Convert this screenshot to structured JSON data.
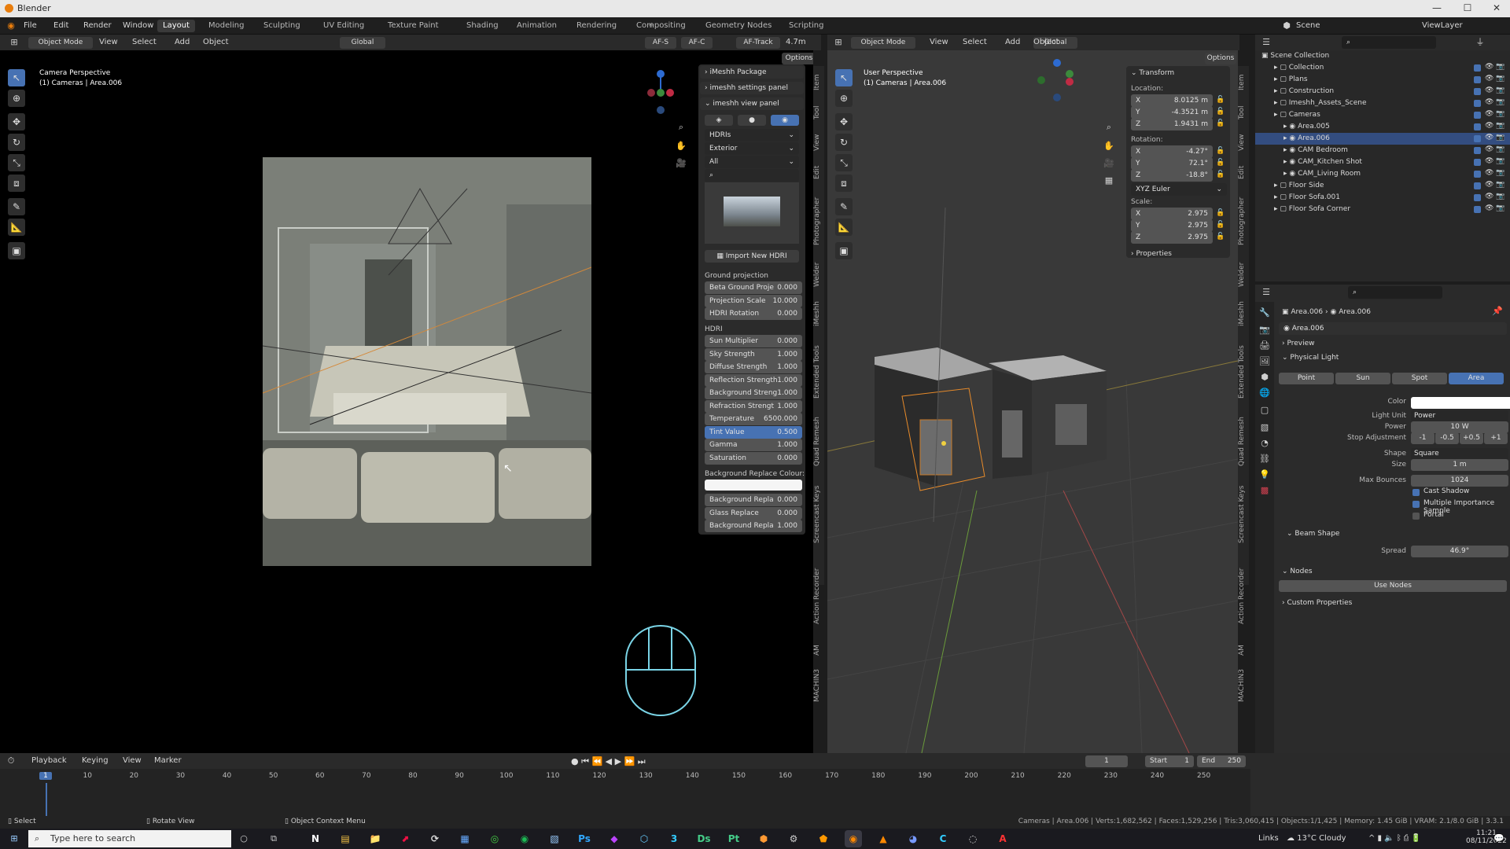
{
  "window": {
    "title": "Blender"
  },
  "menu": [
    "File",
    "Edit",
    "Render",
    "Window",
    "Help"
  ],
  "workspaces": [
    "Layout",
    "Modeling",
    "Sculpting",
    "UV Editing",
    "Texture Paint",
    "Shading",
    "Animation",
    "Rendering",
    "Compositing",
    "Geometry Nodes",
    "Scripting"
  ],
  "active_workspace": "Layout",
  "scene": {
    "name": "Scene",
    "view_layer": "ViewLayer"
  },
  "left_view": {
    "mode": "Object Mode",
    "menus": [
      "View",
      "Select",
      "Add",
      "Object"
    ],
    "orientation": "Global",
    "af_s": "AF-S",
    "af_c": "AF-C",
    "af_track": "AF-Track",
    "focal": "4.7m",
    "options": "Options",
    "perspective": "Camera Perspective",
    "object": "(1) Cameras | Area.006"
  },
  "imeshh": {
    "package": "iMeshh Package",
    "settings": "imeshh settings panel",
    "view": "imeshh view panel",
    "dd1": "HDRIs",
    "dd2": "Exterior",
    "dd3": "All",
    "import": "Import New HDRI",
    "ground_header": "Ground projection",
    "ground": [
      {
        "k": "Beta Ground Proje",
        "v": "0.000"
      },
      {
        "k": "Projection Scale",
        "v": "10.000"
      },
      {
        "k": "HDRI Rotation",
        "v": "0.000"
      }
    ],
    "hdri_header": "HDRI",
    "hdri": [
      {
        "k": "Sun Multiplier",
        "v": "0.000"
      },
      {
        "k": "Sky Strength",
        "v": "1.000"
      },
      {
        "k": "Diffuse Strength",
        "v": "1.000"
      },
      {
        "k": "Reflection Strength",
        "v": "1.000"
      },
      {
        "k": "Background Streng",
        "v": "1.000"
      },
      {
        "k": "Refraction Strengt",
        "v": "1.000"
      },
      {
        "k": "Temperature",
        "v": "6500.000"
      },
      {
        "k": "Tint Value",
        "v": "0.500"
      },
      {
        "k": "Gamma",
        "v": "1.000"
      },
      {
        "k": "Saturation",
        "v": "0.000"
      }
    ],
    "bg_replace_header": "Background Replace Colour:",
    "bg": [
      {
        "k": "Background Repla",
        "v": "0.000"
      },
      {
        "k": "Glass Replace",
        "v": "0.000"
      },
      {
        "k": "Background Repla",
        "v": "1.000"
      }
    ]
  },
  "left_sidetabs": [
    "Item",
    "Tool",
    "View",
    "Edit",
    "Photographer",
    "Welder",
    "iMeshh",
    "Extended Tools",
    "Quad Remesh",
    "Screencast Keys",
    "Action Recorder",
    "AM",
    "MACHIN3"
  ],
  "right_view": {
    "mode": "Object Mode",
    "menus": [
      "View",
      "Select",
      "Add",
      "Object"
    ],
    "orientation": "Global",
    "options": "Options",
    "perspective": "User Perspective",
    "object": "(1) Cameras | Area.006"
  },
  "transform": {
    "title": "Transform",
    "location_label": "Location:",
    "location": [
      {
        "a": "X",
        "v": "8.0125 m"
      },
      {
        "a": "Y",
        "v": "-4.3521 m"
      },
      {
        "a": "Z",
        "v": "1.9431 m"
      }
    ],
    "rotation_label": "Rotation:",
    "rotation": [
      {
        "a": "X",
        "v": "-4.27°"
      },
      {
        "a": "Y",
        "v": "72.1°"
      },
      {
        "a": "Z",
        "v": "-18.8°"
      }
    ],
    "euler": "XYZ Euler",
    "scale_label": "Scale:",
    "scale": [
      {
        "a": "X",
        "v": "2.975"
      },
      {
        "a": "Y",
        "v": "2.975"
      },
      {
        "a": "Z",
        "v": "2.975"
      }
    ],
    "properties": "Properties"
  },
  "right_sidetabs": [
    "Item",
    "Tool",
    "View",
    "Edit",
    "Photographer",
    "Welder",
    "iMeshh",
    "Extended Tools",
    "Quad Remesh",
    "Screencast Keys",
    "Action Recorder",
    "AM",
    "MACHIN3"
  ],
  "outliner": {
    "root": "Scene Collection",
    "items": [
      {
        "name": "Collection",
        "indent": 1,
        "sel": false
      },
      {
        "name": "Plans",
        "indent": 1,
        "sel": false
      },
      {
        "name": "Construction",
        "indent": 1,
        "sel": false
      },
      {
        "name": "Imeshh_Assets_Scene",
        "indent": 1,
        "sel": false
      },
      {
        "name": "Cameras",
        "indent": 1,
        "sel": false
      },
      {
        "name": "Area.005",
        "indent": 2,
        "sel": false
      },
      {
        "name": "Area.006",
        "indent": 2,
        "sel": true
      },
      {
        "name": "CAM Bedroom",
        "indent": 2,
        "sel": false
      },
      {
        "name": "CAM_Kitchen Shot",
        "indent": 2,
        "sel": false
      },
      {
        "name": "CAM_Living Room",
        "indent": 2,
        "sel": false
      },
      {
        "name": "Floor Side",
        "indent": 1,
        "sel": false
      },
      {
        "name": "Floor Sofa.001",
        "indent": 1,
        "sel": false
      },
      {
        "name": "Floor Sofa Corner",
        "indent": 1,
        "sel": false
      }
    ]
  },
  "properties": {
    "breadcrumb_a": "Area.006",
    "breadcrumb_b": "Area.006",
    "datablock": "Area.006",
    "preview": "Preview",
    "physical_light": "Physical Light",
    "light_types": [
      "Point",
      "Sun",
      "Spot",
      "Area"
    ],
    "active_type": "Area",
    "color_label": "Color",
    "light_unit_label": "Light Unit",
    "light_unit": "Power",
    "power_label": "Power",
    "power": "10 W",
    "stop_label": "Stop Adjustment",
    "stops": [
      "-1",
      "-0.5",
      "+0.5",
      "+1"
    ],
    "shape_label": "Shape",
    "shape": "Square",
    "size_label": "Size",
    "size": "1 m",
    "bounces_label": "Max Bounces",
    "bounces": "1024",
    "cast_shadow": "Cast Shadow",
    "mis": "Multiple Importance Sample",
    "portal": "Portal",
    "beam_shape": "Beam Shape",
    "spread_label": "Spread",
    "spread": "46.9°",
    "nodes": "Nodes",
    "use_nodes": "Use Nodes",
    "custom_props": "Custom Properties"
  },
  "timeline": {
    "menus": [
      "Playback",
      "Keying",
      "View",
      "Marker"
    ],
    "current": "1",
    "start_label": "Start",
    "start": "1",
    "end_label": "End",
    "end": "250",
    "ticks": [
      "1",
      "10",
      "20",
      "30",
      "40",
      "50",
      "60",
      "70",
      "80",
      "90",
      "100",
      "110",
      "120",
      "130",
      "140",
      "150",
      "160",
      "170",
      "180",
      "190",
      "200",
      "210",
      "220",
      "230",
      "240",
      "250"
    ]
  },
  "statusbar": {
    "select": "Select",
    "rotate": "Rotate View",
    "context": "Object Context Menu",
    "stats": "Cameras | Area.006 | Verts:1,682,562 | Faces:1,529,256 | Tris:3,060,415 | Objects:1/1,425 | Memory: 1.45 GiB | VRAM: 2.1/8.0 GiB | 3.3.1"
  },
  "taskbar": {
    "search_placeholder": "Type here to search",
    "links": "Links",
    "weather": "13°C  Cloudy",
    "time": "11:21",
    "date": "08/11/2022"
  }
}
